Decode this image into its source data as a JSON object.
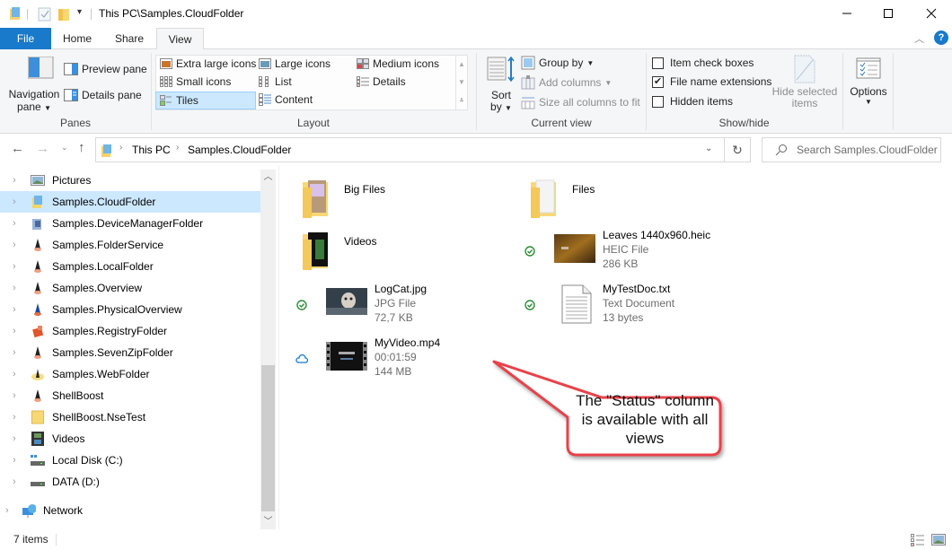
{
  "window": {
    "title": "This PC\\Samples.CloudFolder",
    "minimize_icon": "minimize-icon",
    "maximize_icon": "maximize-icon",
    "close_icon": "close-icon"
  },
  "tabs": [
    {
      "label": "File"
    },
    {
      "label": "Home"
    },
    {
      "label": "Share"
    },
    {
      "label": "View"
    }
  ],
  "ribbon": {
    "panes": {
      "label": "Panes",
      "navigation_pane": "Navigation",
      "navigation_pane_2": "pane",
      "preview_pane": "Preview pane",
      "details_pane": "Details pane"
    },
    "layout": {
      "label": "Layout",
      "items": [
        "Extra large icons",
        "Large icons",
        "Medium icons",
        "Small icons",
        "List",
        "Details",
        "Tiles",
        "Content"
      ],
      "selected": "Tiles"
    },
    "current_view": {
      "label": "Current view",
      "sort_by": "Sort",
      "sort_by_2": "by",
      "group_by": "Group by",
      "add_columns": "Add columns",
      "size_columns": "Size all columns to fit"
    },
    "show_hide": {
      "label": "Show/hide",
      "item_check_boxes": "Item check boxes",
      "item_check_boxes_checked": false,
      "file_name_extensions": "File name extensions",
      "file_name_extensions_checked": true,
      "hidden_items": "Hidden items",
      "hidden_items_checked": false,
      "hide_selected": "Hide selected",
      "hide_selected_2": "items"
    },
    "options": {
      "label": "Options"
    }
  },
  "address": {
    "crumbs": [
      "This PC",
      "Samples.CloudFolder"
    ],
    "search_placeholder": "Search Samples.CloudFolder"
  },
  "nav": {
    "items": [
      {
        "label": "Pictures",
        "icon": "pictures-icon"
      },
      {
        "label": "Samples.CloudFolder",
        "icon": "cloud-folder-icon",
        "selected": true
      },
      {
        "label": "Samples.DeviceManagerFolder",
        "icon": "device-manager-icon"
      },
      {
        "label": "Samples.FolderService",
        "icon": "shellboost-icon"
      },
      {
        "label": "Samples.LocalFolder",
        "icon": "shellboost-icon"
      },
      {
        "label": "Samples.Overview",
        "icon": "shellboost-icon"
      },
      {
        "label": "Samples.PhysicalOverview",
        "icon": "shellboost-icon"
      },
      {
        "label": "Samples.RegistryFolder",
        "icon": "registry-icon"
      },
      {
        "label": "Samples.SevenZipFolder",
        "icon": "shellboost-icon"
      },
      {
        "label": "Samples.WebFolder",
        "icon": "web-folder-icon"
      },
      {
        "label": "ShellBoost",
        "icon": "shellboost-icon"
      },
      {
        "label": "ShellBoost.NseTest",
        "icon": "folder-icon"
      },
      {
        "label": "Videos",
        "icon": "videos-icon"
      },
      {
        "label": "Local Disk (C:)",
        "icon": "local-disk-icon"
      },
      {
        "label": "DATA (D:)",
        "icon": "drive-icon"
      },
      {
        "label": "Network",
        "icon": "network-icon"
      }
    ]
  },
  "files": [
    {
      "name": "Big Files",
      "type": "folder",
      "lines": [],
      "status": ""
    },
    {
      "name": "Files",
      "type": "folder",
      "lines": [],
      "status": ""
    },
    {
      "name": "Videos",
      "type": "folder",
      "lines": [],
      "status": ""
    },
    {
      "name": "Leaves 1440x960.heic",
      "type": "image",
      "lines": [
        "HEIC File",
        "286 KB"
      ],
      "status": "synced"
    },
    {
      "name": "LogCat.jpg",
      "type": "image",
      "lines": [
        "JPG File",
        "72,7 KB"
      ],
      "status": "synced"
    },
    {
      "name": "MyTestDoc.txt",
      "type": "text",
      "lines": [
        "Text Document",
        "13 bytes"
      ],
      "status": "synced"
    },
    {
      "name": "MyVideo.mp4",
      "type": "video",
      "lines": [
        "00:01:59",
        "144 MB"
      ],
      "status": "cloud"
    }
  ],
  "status_bar": {
    "count": "7 items"
  },
  "callout": {
    "text": "The \"Status\" column is available with all views",
    "color": "#e8434a"
  },
  "colors": {
    "accent": "#1979ca",
    "selected": "#cce8ff",
    "sync_green": "#2e8b3a",
    "cloud_blue": "#1979ca"
  }
}
